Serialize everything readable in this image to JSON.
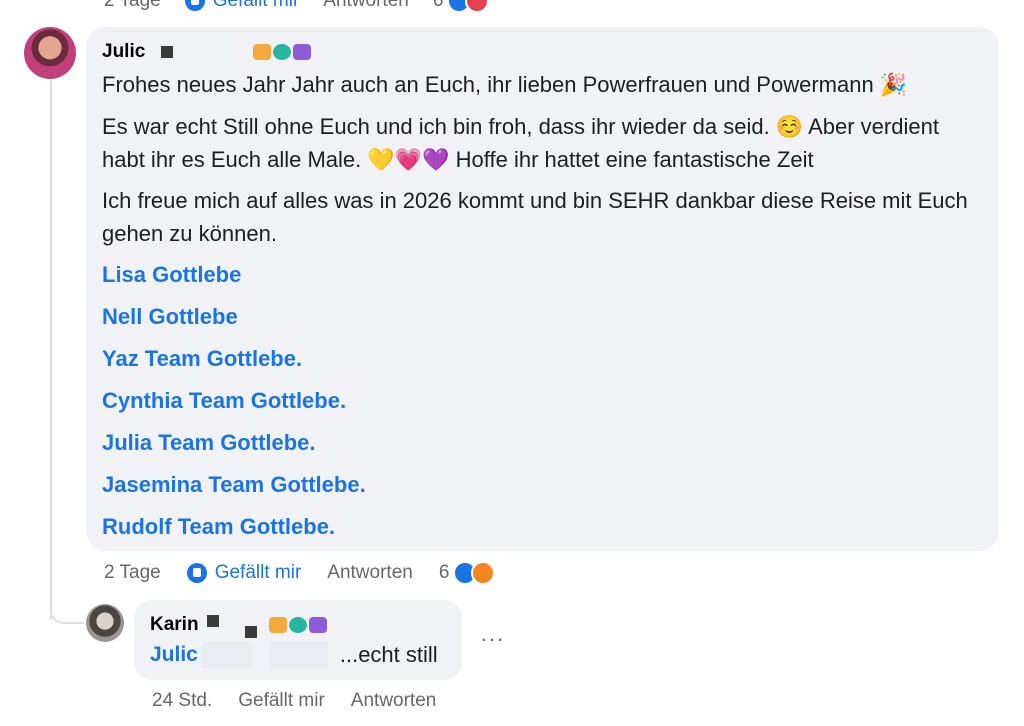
{
  "top_actions": {
    "time": "2 Tage",
    "like_label": "Gefällt mir",
    "reply_label": "Antworten",
    "reaction_count": "6"
  },
  "comment": {
    "author": "Julic",
    "paragraphs": [
      "Frohes neues Jahr Jahr auch an Euch, ihr lieben Powerfrauen und Powermann 🎉",
      "Es war echt Still ohne Euch und ich bin froh, dass ihr wieder da seid. ☺️ Aber verdient habt ihr es Euch alle Male. 💛💗💜 Hoffe ihr hattet eine fantastische Zeit",
      "Ich freue mich auf alles was in 2026 kommt und bin SEHR dankbar diese Reise mit Euch gehen zu können."
    ],
    "mentions": [
      "Lisa Gottlebe",
      "Nell Gottlebe",
      "Yaz Team Gottlebe.",
      "Cynthia Team Gottlebe.",
      "Julia Team Gottlebe.",
      "Jasemina Team Gottlebe.",
      "Rudolf Team Gottlebe."
    ],
    "actions": {
      "time": "2 Tage",
      "like_label": "Gefällt mir",
      "reply_label": "Antworten",
      "reaction_count": "6"
    }
  },
  "reply": {
    "author": "Karin",
    "mention": "Julic",
    "text": "...echt still",
    "more": "···",
    "actions": {
      "time": "24 Std.",
      "like_label": "Gefällt mir",
      "reply_label": "Antworten"
    }
  },
  "colors": {
    "link_blue": "#1b74e4",
    "bubble_bg": "#f0f2f5",
    "meta_grey": "#65676b"
  },
  "icons": [
    "like-icon",
    "fire-reaction-icon",
    "heart-reaction-icon",
    "more-options-icon",
    "badge-icons"
  ]
}
